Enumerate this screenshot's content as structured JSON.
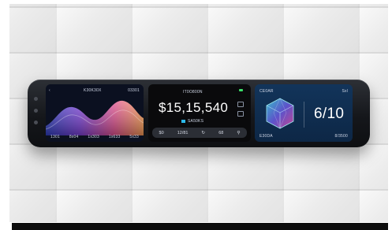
{
  "colors": {
    "accent": "#2bb8e8",
    "status": "#3be06a",
    "device": "#15171b",
    "panel_blue": "#12345a"
  },
  "panel_left": {
    "title": "K30K30X",
    "right_label": "03301",
    "axis_labels": [
      "1301",
      "8x04",
      "1x303",
      "1x633",
      "5x33"
    ]
  },
  "panel_center": {
    "title": "IT0O800N",
    "amount": "$15,15,540",
    "tag": "SA50KS",
    "pill_items": [
      "$0",
      "12/81",
      "↻",
      "68",
      "⚲"
    ]
  },
  "panel_right": {
    "title": "CE0AR",
    "right_label": "Sxl",
    "score": "6/10",
    "bottom_left": "E30DA",
    "bottom_right": "8/3500"
  }
}
